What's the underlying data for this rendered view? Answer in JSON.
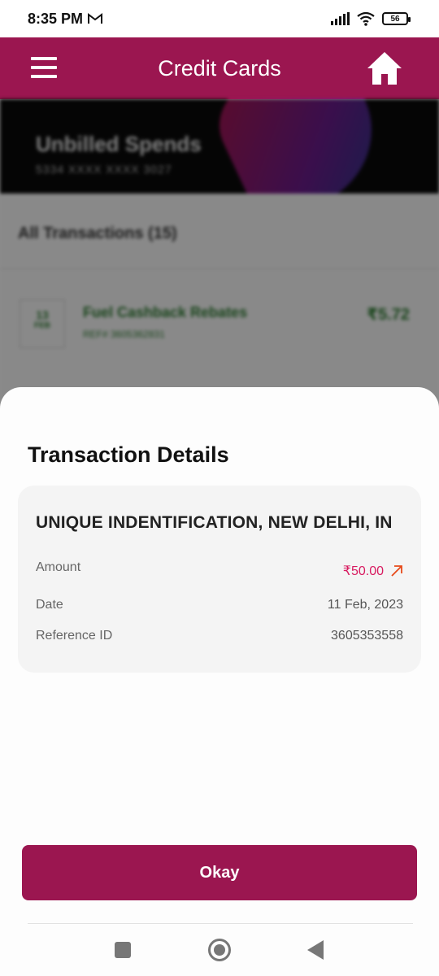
{
  "status_bar": {
    "time": "8:35 PM",
    "battery": "56"
  },
  "header": {
    "title": "Credit Cards"
  },
  "background": {
    "card_title": "Unbilled Spends",
    "card_number": "5334 XXXX XXXX 3027",
    "list_heading": "All Transactions (15)",
    "transaction": {
      "day": "13",
      "month": "FEB",
      "title": "Fuel Cashback Rebates",
      "ref": "REF# 3605362831",
      "amount": "₹5.72"
    }
  },
  "sheet": {
    "title": "Transaction Details",
    "merchant": "UNIQUE INDENTIFICATION, NEW DELHI, IN",
    "rows": {
      "amount": {
        "label": "Amount",
        "value": "₹50.00"
      },
      "date": {
        "label": "Date",
        "value": "11 Feb, 2023"
      },
      "reference": {
        "label": "Reference ID",
        "value": "3605353558"
      }
    },
    "button_label": "Okay"
  },
  "colors": {
    "brand": "#9b1650",
    "debit": "#d81b60",
    "arrow": "#e64a19"
  }
}
